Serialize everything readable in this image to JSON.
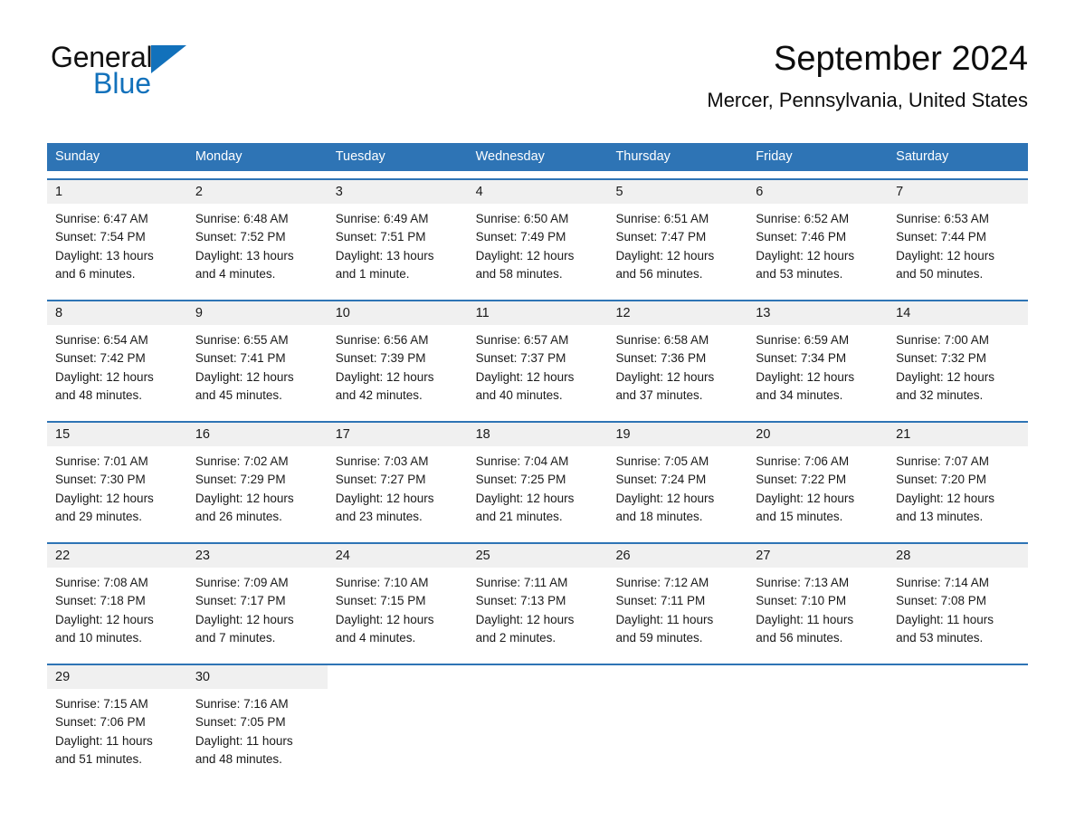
{
  "brand": {
    "name_part1": "General",
    "name_part2": "Blue",
    "triangle_color": "#1271bb"
  },
  "header": {
    "title": "September 2024",
    "subtitle": "Mercer, Pennsylvania, United States"
  },
  "theme": {
    "header_blue": "#2e74b5",
    "day_band_gray": "#f0f0f0",
    "text_color": "#1a1a1a",
    "page_background": "#ffffff"
  },
  "calendar": {
    "weekdays": [
      "Sunday",
      "Monday",
      "Tuesday",
      "Wednesday",
      "Thursday",
      "Friday",
      "Saturday"
    ],
    "weeks": [
      [
        {
          "day": "1",
          "sunrise": "Sunrise: 6:47 AM",
          "sunset": "Sunset: 7:54 PM",
          "daylight1": "Daylight: 13 hours",
          "daylight2": "and 6 minutes."
        },
        {
          "day": "2",
          "sunrise": "Sunrise: 6:48 AM",
          "sunset": "Sunset: 7:52 PM",
          "daylight1": "Daylight: 13 hours",
          "daylight2": "and 4 minutes."
        },
        {
          "day": "3",
          "sunrise": "Sunrise: 6:49 AM",
          "sunset": "Sunset: 7:51 PM",
          "daylight1": "Daylight: 13 hours",
          "daylight2": "and 1 minute."
        },
        {
          "day": "4",
          "sunrise": "Sunrise: 6:50 AM",
          "sunset": "Sunset: 7:49 PM",
          "daylight1": "Daylight: 12 hours",
          "daylight2": "and 58 minutes."
        },
        {
          "day": "5",
          "sunrise": "Sunrise: 6:51 AM",
          "sunset": "Sunset: 7:47 PM",
          "daylight1": "Daylight: 12 hours",
          "daylight2": "and 56 minutes."
        },
        {
          "day": "6",
          "sunrise": "Sunrise: 6:52 AM",
          "sunset": "Sunset: 7:46 PM",
          "daylight1": "Daylight: 12 hours",
          "daylight2": "and 53 minutes."
        },
        {
          "day": "7",
          "sunrise": "Sunrise: 6:53 AM",
          "sunset": "Sunset: 7:44 PM",
          "daylight1": "Daylight: 12 hours",
          "daylight2": "and 50 minutes."
        }
      ],
      [
        {
          "day": "8",
          "sunrise": "Sunrise: 6:54 AM",
          "sunset": "Sunset: 7:42 PM",
          "daylight1": "Daylight: 12 hours",
          "daylight2": "and 48 minutes."
        },
        {
          "day": "9",
          "sunrise": "Sunrise: 6:55 AM",
          "sunset": "Sunset: 7:41 PM",
          "daylight1": "Daylight: 12 hours",
          "daylight2": "and 45 minutes."
        },
        {
          "day": "10",
          "sunrise": "Sunrise: 6:56 AM",
          "sunset": "Sunset: 7:39 PM",
          "daylight1": "Daylight: 12 hours",
          "daylight2": "and 42 minutes."
        },
        {
          "day": "11",
          "sunrise": "Sunrise: 6:57 AM",
          "sunset": "Sunset: 7:37 PM",
          "daylight1": "Daylight: 12 hours",
          "daylight2": "and 40 minutes."
        },
        {
          "day": "12",
          "sunrise": "Sunrise: 6:58 AM",
          "sunset": "Sunset: 7:36 PM",
          "daylight1": "Daylight: 12 hours",
          "daylight2": "and 37 minutes."
        },
        {
          "day": "13",
          "sunrise": "Sunrise: 6:59 AM",
          "sunset": "Sunset: 7:34 PM",
          "daylight1": "Daylight: 12 hours",
          "daylight2": "and 34 minutes."
        },
        {
          "day": "14",
          "sunrise": "Sunrise: 7:00 AM",
          "sunset": "Sunset: 7:32 PM",
          "daylight1": "Daylight: 12 hours",
          "daylight2": "and 32 minutes."
        }
      ],
      [
        {
          "day": "15",
          "sunrise": "Sunrise: 7:01 AM",
          "sunset": "Sunset: 7:30 PM",
          "daylight1": "Daylight: 12 hours",
          "daylight2": "and 29 minutes."
        },
        {
          "day": "16",
          "sunrise": "Sunrise: 7:02 AM",
          "sunset": "Sunset: 7:29 PM",
          "daylight1": "Daylight: 12 hours",
          "daylight2": "and 26 minutes."
        },
        {
          "day": "17",
          "sunrise": "Sunrise: 7:03 AM",
          "sunset": "Sunset: 7:27 PM",
          "daylight1": "Daylight: 12 hours",
          "daylight2": "and 23 minutes."
        },
        {
          "day": "18",
          "sunrise": "Sunrise: 7:04 AM",
          "sunset": "Sunset: 7:25 PM",
          "daylight1": "Daylight: 12 hours",
          "daylight2": "and 21 minutes."
        },
        {
          "day": "19",
          "sunrise": "Sunrise: 7:05 AM",
          "sunset": "Sunset: 7:24 PM",
          "daylight1": "Daylight: 12 hours",
          "daylight2": "and 18 minutes."
        },
        {
          "day": "20",
          "sunrise": "Sunrise: 7:06 AM",
          "sunset": "Sunset: 7:22 PM",
          "daylight1": "Daylight: 12 hours",
          "daylight2": "and 15 minutes."
        },
        {
          "day": "21",
          "sunrise": "Sunrise: 7:07 AM",
          "sunset": "Sunset: 7:20 PM",
          "daylight1": "Daylight: 12 hours",
          "daylight2": "and 13 minutes."
        }
      ],
      [
        {
          "day": "22",
          "sunrise": "Sunrise: 7:08 AM",
          "sunset": "Sunset: 7:18 PM",
          "daylight1": "Daylight: 12 hours",
          "daylight2": "and 10 minutes."
        },
        {
          "day": "23",
          "sunrise": "Sunrise: 7:09 AM",
          "sunset": "Sunset: 7:17 PM",
          "daylight1": "Daylight: 12 hours",
          "daylight2": "and 7 minutes."
        },
        {
          "day": "24",
          "sunrise": "Sunrise: 7:10 AM",
          "sunset": "Sunset: 7:15 PM",
          "daylight1": "Daylight: 12 hours",
          "daylight2": "and 4 minutes."
        },
        {
          "day": "25",
          "sunrise": "Sunrise: 7:11 AM",
          "sunset": "Sunset: 7:13 PM",
          "daylight1": "Daylight: 12 hours",
          "daylight2": "and 2 minutes."
        },
        {
          "day": "26",
          "sunrise": "Sunrise: 7:12 AM",
          "sunset": "Sunset: 7:11 PM",
          "daylight1": "Daylight: 11 hours",
          "daylight2": "and 59 minutes."
        },
        {
          "day": "27",
          "sunrise": "Sunrise: 7:13 AM",
          "sunset": "Sunset: 7:10 PM",
          "daylight1": "Daylight: 11 hours",
          "daylight2": "and 56 minutes."
        },
        {
          "day": "28",
          "sunrise": "Sunrise: 7:14 AM",
          "sunset": "Sunset: 7:08 PM",
          "daylight1": "Daylight: 11 hours",
          "daylight2": "and 53 minutes."
        }
      ],
      [
        {
          "day": "29",
          "sunrise": "Sunrise: 7:15 AM",
          "sunset": "Sunset: 7:06 PM",
          "daylight1": "Daylight: 11 hours",
          "daylight2": "and 51 minutes."
        },
        {
          "day": "30",
          "sunrise": "Sunrise: 7:16 AM",
          "sunset": "Sunset: 7:05 PM",
          "daylight1": "Daylight: 11 hours",
          "daylight2": "and 48 minutes."
        },
        {
          "day": "",
          "sunrise": "",
          "sunset": "",
          "daylight1": "",
          "daylight2": ""
        },
        {
          "day": "",
          "sunrise": "",
          "sunset": "",
          "daylight1": "",
          "daylight2": ""
        },
        {
          "day": "",
          "sunrise": "",
          "sunset": "",
          "daylight1": "",
          "daylight2": ""
        },
        {
          "day": "",
          "sunrise": "",
          "sunset": "",
          "daylight1": "",
          "daylight2": ""
        },
        {
          "day": "",
          "sunrise": "",
          "sunset": "",
          "daylight1": "",
          "daylight2": ""
        }
      ]
    ]
  }
}
